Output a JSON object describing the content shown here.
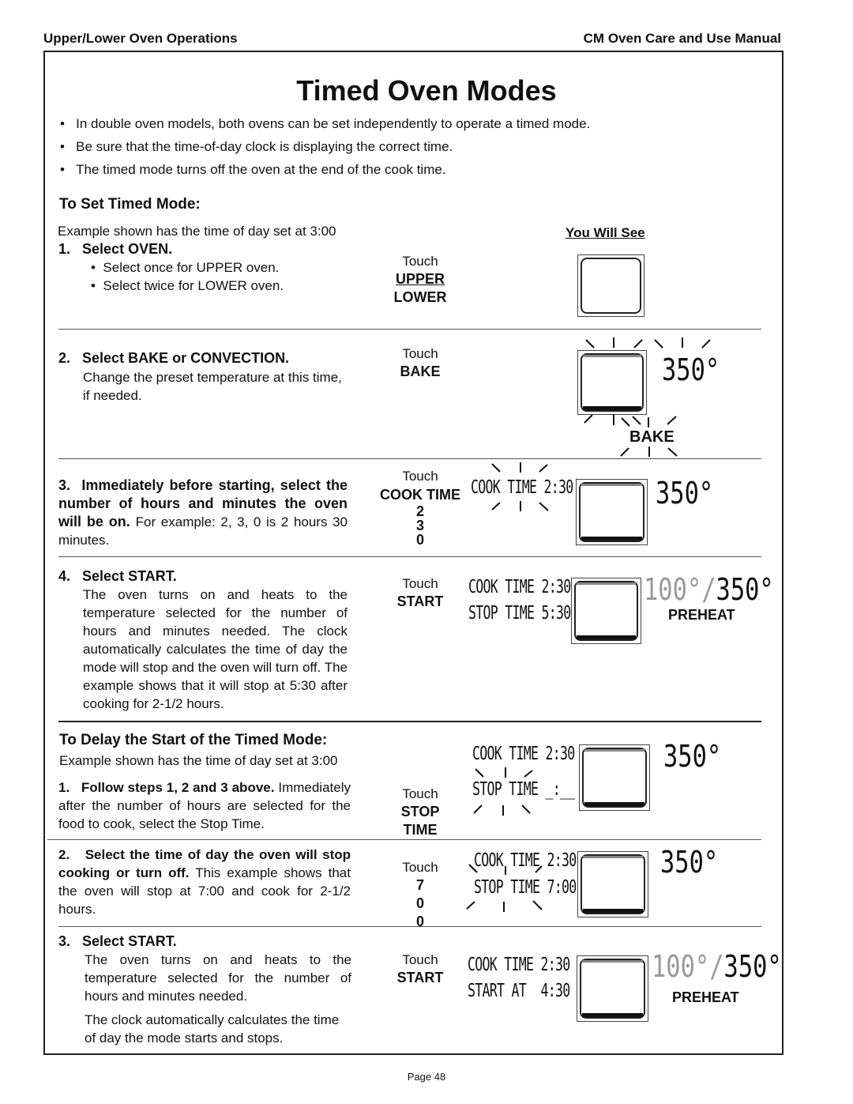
{
  "header": {
    "left": "Upper/Lower Oven Operations",
    "right": "CM Oven Care and Use Manual"
  },
  "title": "Timed Oven Modes",
  "bullets": [
    "In double oven models, both ovens can be set independently to operate a timed mode.",
    "Be sure that the time-of-day clock is displaying the correct time.",
    "The timed mode turns off the oven at the end of the cook time."
  ],
  "set": {
    "heading": "To Set  Timed Mode:",
    "example": "Example shown has the time of day set at 3:00",
    "you_will_see": "You Will See",
    "step1": {
      "num": "1.",
      "title": "Select OVEN.",
      "sub": [
        "Select once for UPPER oven.",
        "Select twice for LOWER oven."
      ],
      "touch": "Touch",
      "keys": [
        "UPPER",
        "LOWER"
      ]
    },
    "step2": {
      "num": "2.",
      "title": "Select  BAKE or CONVECTION.",
      "text": "Change the preset temperature at this time, if needed.",
      "touch": "Touch",
      "keys": [
        "BAKE"
      ],
      "temp": "350°",
      "mode": "BAKE"
    },
    "step3": {
      "num": "3.",
      "title": "Immediately before starting, select the number of hours and minutes the oven will be on.",
      "text": "For example: 2, 3, 0 is 2 hours 30 minutes.",
      "touch": "Touch",
      "keys": [
        "COOK TIME",
        "2",
        "3",
        "0"
      ],
      "lcd": "COOK TIME 2:30",
      "temp": "350°"
    },
    "step4": {
      "num": "4.",
      "title": "Select START.",
      "text": "The oven turns on and heats to the temperature selected for the number of hours and minutes needed. The clock automatically calculates the time of day the mode will stop and the oven will turn off. The example shows that it will stop at 5:30 after cooking for 2-1/2 hours.",
      "touch": "Touch",
      "keys": [
        "START"
      ],
      "lcd1": "COOK TIME 2:30",
      "lcd2": "STOP TIME 5:30",
      "temp_current": "100°",
      "temp_sep": "/",
      "temp_set": "350°",
      "status": "PREHEAT"
    }
  },
  "delay": {
    "heading": "To Delay the Start of the Timed Mode:",
    "example": "Example shown has the time of day set at 3:00",
    "step1": {
      "num": "1.",
      "title": "Follow steps 1, 2 and 3 above.",
      "text": "Immediately after the number of hours are selected for the food to cook, select the Stop Time.",
      "touch": "Touch",
      "keys": [
        "STOP",
        "TIME"
      ],
      "lcd1": "COOK TIME 2:30",
      "lcd2": "STOP TIME _:__",
      "temp": "350°"
    },
    "step2": {
      "num": "2.",
      "title": "Select the time of day the oven will stop cooking or turn off.",
      "text": "This example shows that the oven will stop at 7:00 and cook for 2-1/2 hours.",
      "touch": "Touch",
      "keys": [
        "7",
        "0",
        "0"
      ],
      "lcd1": "COOK TIME 2:30",
      "lcd2": "STOP TIME 7:00",
      "temp": "350°"
    },
    "step3": {
      "num": "3.",
      "title": "Select START.",
      "text": "The oven turns on and heats to the temperature selected for the number of hours and minutes needed.",
      "text2": "The clock automatically calculates the time of day the mode starts and stops.",
      "touch": "Touch",
      "keys": [
        "START"
      ],
      "lcd1": "COOK TIME 2:30",
      "lcd2": "START AT  4:30",
      "temp_current": "100°",
      "temp_sep": "/",
      "temp_set": "350°",
      "status": "PREHEAT"
    }
  },
  "footer": "Page 48"
}
